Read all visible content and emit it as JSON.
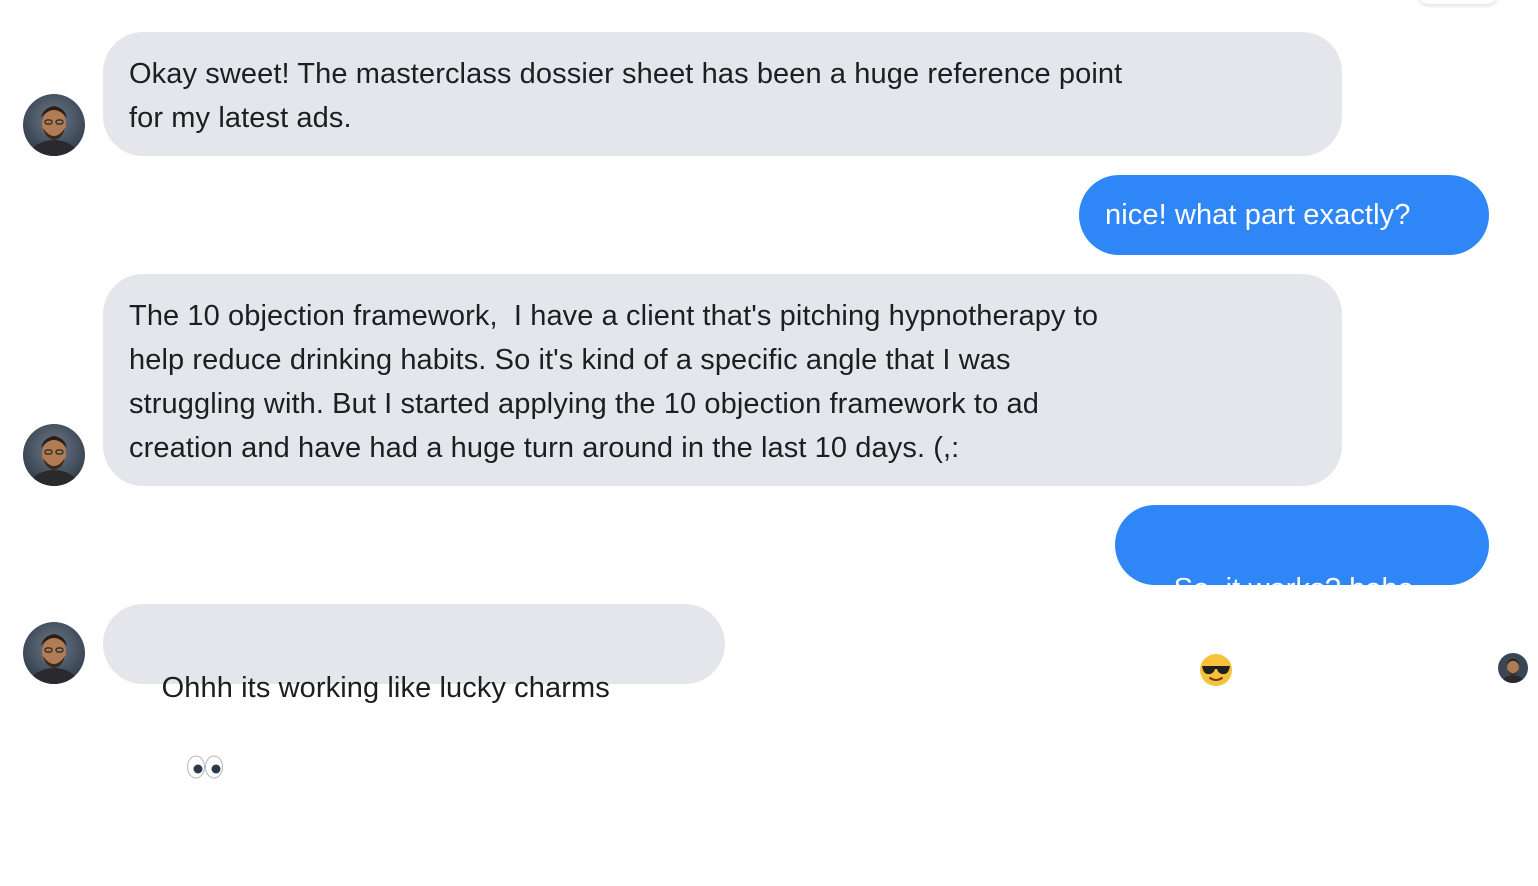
{
  "colors": {
    "incoming_bubble": "#e5e6eb",
    "outgoing_bubble": "#2f86f6",
    "incoming_text": "#1c1e21",
    "outgoing_text": "#ffffff"
  },
  "messages": [
    {
      "sender": "contact",
      "text": "Okay sweet! The masterclass dossier sheet has been a huge reference point\nfor my latest ads."
    },
    {
      "sender": "me",
      "text": "nice! what part exactly?"
    },
    {
      "sender": "contact",
      "text": "The 10 objection framework,  I have a client that's pitching hypnotherapy to\nhelp reduce drinking habits. So it's kind of a specific angle that I was\nstruggling with. But I started applying the 10 objection framework to ad\ncreation and have had a huge turn around in the last 10 days. (,:"
    },
    {
      "sender": "me",
      "text": "So, it works? haha",
      "emoji": "sunglasses-emoji"
    },
    {
      "sender": "contact",
      "text": "Ohhh its working like lucky charms",
      "emoji": "eyes-emoji"
    }
  ],
  "icons": {
    "contact_avatar": "avatar-photo",
    "read_receipt": "seen-avatar"
  }
}
